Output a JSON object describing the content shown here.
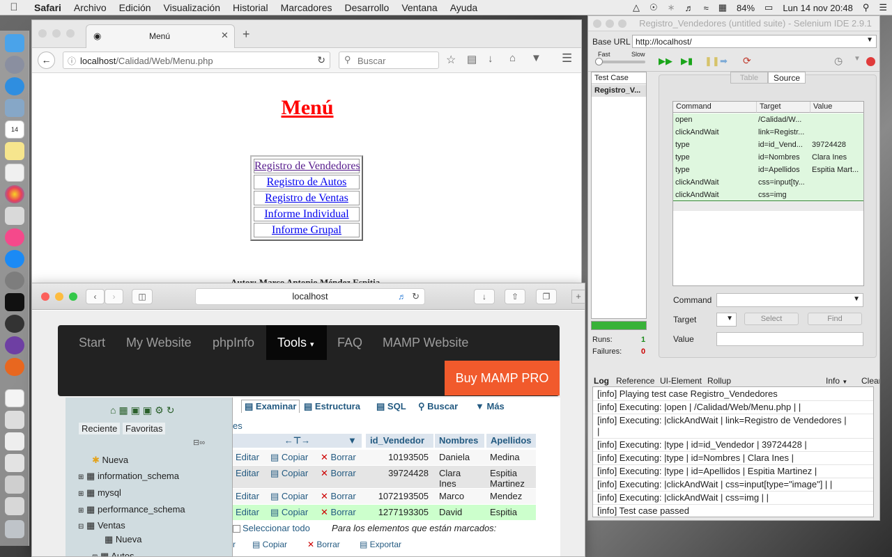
{
  "menubar": {
    "apple": "",
    "app": "Safari",
    "items": [
      "Archivo",
      "Edición",
      "Visualización",
      "Historial",
      "Marcadores",
      "Desarrollo",
      "Ventana",
      "Ayuda"
    ],
    "battery": "84%",
    "datetime": "Lun 14 nov  20:48"
  },
  "firefox": {
    "tab_title": "Menú",
    "url_host": "localhost",
    "url_path": "/Calidad/Web/Menu.php",
    "search_placeholder": "Buscar",
    "page": {
      "title": "Menú",
      "links": [
        "Registro de Vendedores",
        "Registro de Autos",
        "Registro de Ventas",
        "Informe Individual",
        "Informe Grupal"
      ],
      "author": "Autor: Marco Antonio Méndez Espitia"
    }
  },
  "safari": {
    "url": "localhost",
    "mamp_nav": [
      "Start",
      "My Website",
      "phpInfo",
      "Tools",
      "FAQ",
      "MAMP Website"
    ],
    "mamp_active_caret": "▾",
    "mamp_buy": "Buy MAMP PRO",
    "pma": {
      "recent": "Reciente",
      "favorites": "Favoritas",
      "tree": [
        "Nueva",
        "information_schema",
        "mysql",
        "performance_schema",
        "Ventas",
        "Nueva",
        "Autos"
      ],
      "tabs": [
        "Examinar",
        "Estructura",
        "SQL",
        "Buscar",
        "Más"
      ],
      "es_text": "es",
      "columns": [
        "id_Vendedor",
        "Nombres",
        "Apellidos"
      ],
      "rows": [
        {
          "edit": "Editar",
          "copy": "Copiar",
          "del": "Borrar",
          "id": "10193505",
          "nombres": "Daniela",
          "apellidos": "Medina"
        },
        {
          "edit": "Editar",
          "copy": "Copiar",
          "del": "Borrar",
          "id": "39724428",
          "nombres": "Clara Ines",
          "apellidos": "Espitia Martinez"
        },
        {
          "edit": "Editar",
          "copy": "Copiar",
          "del": "Borrar",
          "id": "1072193505",
          "nombres": "Marco",
          "apellidos": "Mendez"
        },
        {
          "edit": "Editar",
          "copy": "Copiar",
          "del": "Borrar",
          "id": "1277193305",
          "nombres": "David",
          "apellidos": "Espitia"
        }
      ],
      "select_all": "Seleccionar todo",
      "marked": "Para los elementos que están marcados:",
      "bottom_actions": [
        "r",
        "Copiar",
        "Borrar",
        "Exportar"
      ]
    }
  },
  "selenium": {
    "title": "Registro_Vendedores (untitled suite) - Selenium IDE 2.9.1",
    "base_url_label": "Base URL",
    "base_url": "http://localhost/",
    "fast": "Fast",
    "slow": "Slow",
    "test_case_header": "Test Case",
    "test_case": "Registro_V...",
    "tab_table": "Table",
    "tab_source": "Source",
    "columns": [
      "Command",
      "Target",
      "Value"
    ],
    "commands": [
      {
        "cmd": "open",
        "target": "/Calidad/W...",
        "value": ""
      },
      {
        "cmd": "clickAndWait",
        "target": "link=Registr...",
        "value": ""
      },
      {
        "cmd": "type",
        "target": "id=id_Vend...",
        "value": "39724428"
      },
      {
        "cmd": "type",
        "target": "id=Nombres",
        "value": "Clara Ines"
      },
      {
        "cmd": "type",
        "target": "id=Apellidos",
        "value": "Espitia Mart..."
      },
      {
        "cmd": "clickAndWait",
        "target": "css=input[ty...",
        "value": ""
      },
      {
        "cmd": "clickAndWait",
        "target": "css=img",
        "value": ""
      }
    ],
    "command_label": "Command",
    "target_label": "Target",
    "value_label": "Value",
    "select_btn": "Select",
    "find_btn": "Find",
    "runs_label": "Runs:",
    "runs": "1",
    "failures_label": "Failures:",
    "failures": "0",
    "log_tabs": [
      "Log",
      "Reference",
      "UI-Element",
      "Rollup"
    ],
    "log_level": "Info",
    "clear": "Clear",
    "log": [
      "[info] Playing test case Registro_Vendedores",
      "[info] Executing: |open | /Calidad/Web/Menu.php | |",
      "[info] Executing: |clickAndWait | link=Registro de Vendedores |",
      "|",
      "[info] Executing: |type | id=id_Vendedor | 39724428 |",
      "[info] Executing: |type | id=Nombres | Clara Ines |",
      "[info] Executing: |type | id=Apellidos | Espitia Martinez |",
      "[info] Executing: |clickAndWait | css=input[type=\"image\"] | |",
      "[info] Executing: |clickAndWait | css=img | |",
      "[info] Test case passed"
    ]
  },
  "dock_badge_date": "14",
  "dock_calendar_month": "NOV"
}
